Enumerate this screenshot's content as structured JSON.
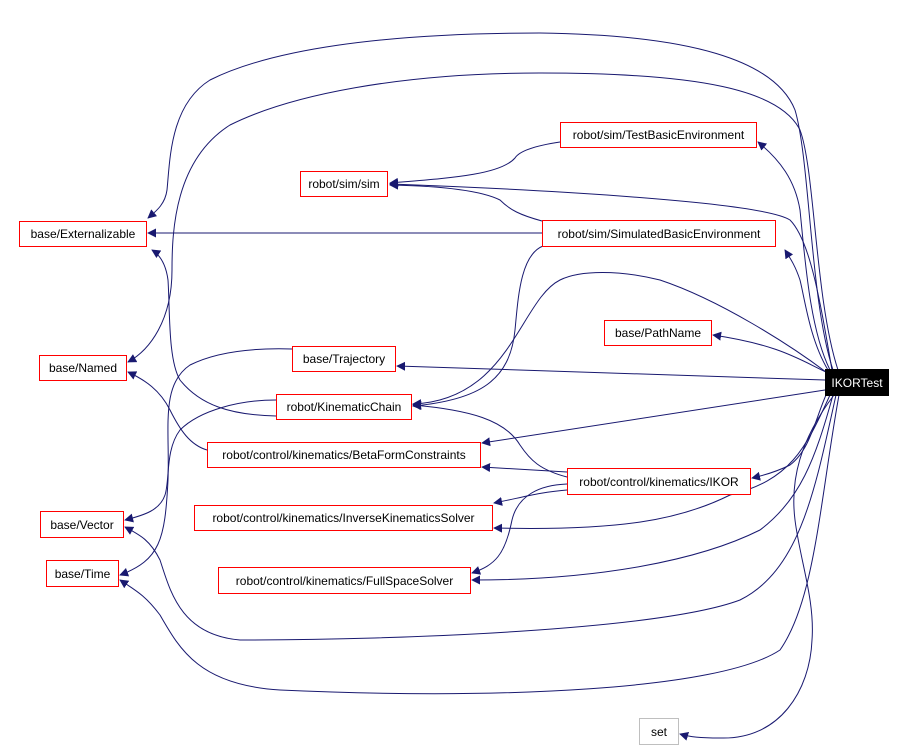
{
  "diagram": {
    "type": "include-dependency-graph",
    "edge_color": "#191970",
    "node_border_color": "#ff0000",
    "external_border_color": "#bfbfbf",
    "root": "IKORTest",
    "nodes": [
      {
        "id": "externalizable",
        "label": "base/Externalizable"
      },
      {
        "id": "sim",
        "label": "robot/sim/sim"
      },
      {
        "id": "testbasicenv",
        "label": "robot/sim/TestBasicEnvironment"
      },
      {
        "id": "simbasicenv",
        "label": "robot/sim/SimulatedBasicEnvironment"
      },
      {
        "id": "pathname",
        "label": "base/PathName"
      },
      {
        "id": "named",
        "label": "base/Named"
      },
      {
        "id": "trajectory",
        "label": "base/Trajectory"
      },
      {
        "id": "ikortest",
        "label": "IKORTest"
      },
      {
        "id": "kinchain",
        "label": "robot/KinematicChain"
      },
      {
        "id": "betaform",
        "label": "robot/control/kinematics/BetaFormConstraints"
      },
      {
        "id": "ikor",
        "label": "robot/control/kinematics/IKOR"
      },
      {
        "id": "iksolver",
        "label": "robot/control/kinematics/InverseKinematicsSolver"
      },
      {
        "id": "vector",
        "label": "base/Vector"
      },
      {
        "id": "time",
        "label": "base/Time"
      },
      {
        "id": "fullspace",
        "label": "robot/control/kinematics/FullSpaceSolver"
      },
      {
        "id": "set",
        "label": "set"
      }
    ],
    "edges": [
      {
        "from": "ikortest",
        "to": "testbasicenv"
      },
      {
        "from": "ikortest",
        "to": "sim"
      },
      {
        "from": "ikortest",
        "to": "simbasicenv"
      },
      {
        "from": "ikortest",
        "to": "pathname"
      },
      {
        "from": "ikortest",
        "to": "trajectory"
      },
      {
        "from": "ikortest",
        "to": "kinchain"
      },
      {
        "from": "ikortest",
        "to": "betaform"
      },
      {
        "from": "ikortest",
        "to": "ikor"
      },
      {
        "from": "ikortest",
        "to": "iksolver"
      },
      {
        "from": "ikortest",
        "to": "fullspace"
      },
      {
        "from": "ikortest",
        "to": "externalizable"
      },
      {
        "from": "ikortest",
        "to": "named"
      },
      {
        "from": "ikortest",
        "to": "vector"
      },
      {
        "from": "ikortest",
        "to": "time"
      },
      {
        "from": "ikortest",
        "to": "set"
      },
      {
        "from": "testbasicenv",
        "to": "sim"
      },
      {
        "from": "simbasicenv",
        "to": "sim"
      },
      {
        "from": "simbasicenv",
        "to": "externalizable"
      },
      {
        "from": "simbasicenv",
        "to": "kinchain"
      },
      {
        "from": "trajectory",
        "to": "time"
      },
      {
        "from": "kinchain",
        "to": "externalizable"
      },
      {
        "from": "kinchain",
        "to": "vector"
      },
      {
        "from": "betaform",
        "to": "named"
      },
      {
        "from": "ikor",
        "to": "kinchain"
      },
      {
        "from": "ikor",
        "to": "betaform"
      },
      {
        "from": "ikor",
        "to": "iksolver"
      },
      {
        "from": "ikor",
        "to": "fullspace"
      }
    ]
  }
}
